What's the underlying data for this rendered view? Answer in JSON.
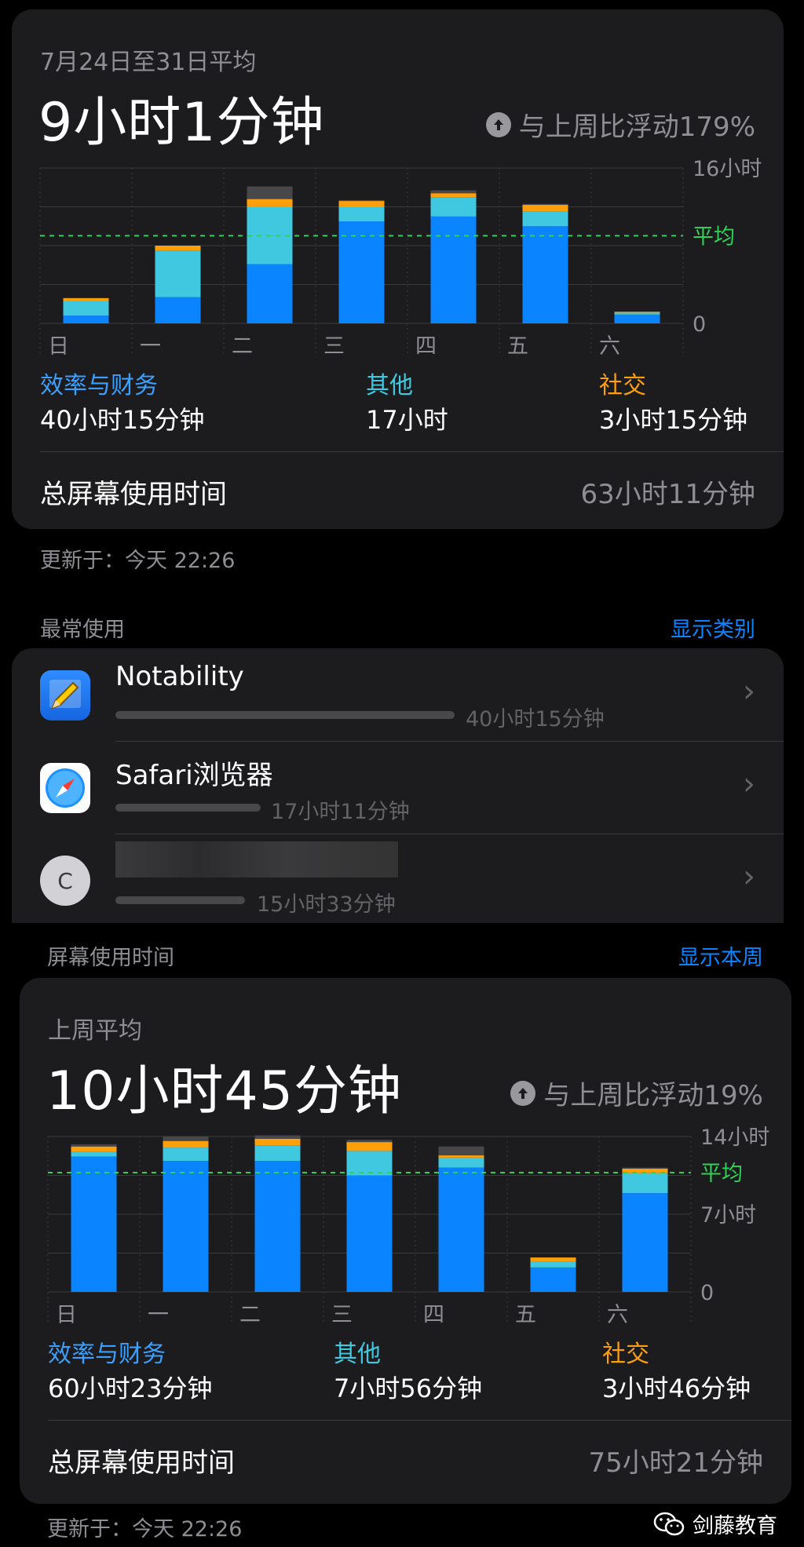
{
  "colors": {
    "productivity": "#0a84ff",
    "other": "#40c8e0",
    "social": "#ff9f0a",
    "misc": "#48484a",
    "average": "#30d158",
    "grid": "#3a3a3c",
    "link": "#0a84ff"
  },
  "summary1": {
    "range_label": "7月24日至31日平均",
    "avg": "9小时1分钟",
    "compare": "与上周比浮动179%",
    "legend": [
      {
        "name": "效率与财务",
        "value": "40小时15分钟",
        "color": "#3aa0ff"
      },
      {
        "name": "其他",
        "value": "17小时",
        "color": "#40c8e0"
      },
      {
        "name": "社交",
        "value": "3小时15分钟",
        "color": "#ff9f0a"
      }
    ],
    "total_label": "总屏幕使用时间",
    "total_value": "63小时11分钟"
  },
  "updated1": "更新于：今天 22:26",
  "most_used": {
    "title": "最常使用",
    "link": "显示类别",
    "apps": [
      {
        "name": "Notability",
        "time": "40小时15分钟",
        "usage": 40.25,
        "icon": "notability-icon"
      },
      {
        "name": "Safari浏览器",
        "time": "17小时11分钟",
        "usage": 17.18,
        "icon": "safari-icon"
      },
      {
        "name": "",
        "time": "15小时33分钟",
        "usage": 15.55,
        "icon": "c-avatar-icon",
        "letter": "C"
      }
    ]
  },
  "screen_time": {
    "title": "屏幕使用时间",
    "link": "显示本周"
  },
  "summary2": {
    "range_label": "上周平均",
    "avg": "10小时45分钟",
    "compare": "与上周比浮动19%",
    "legend": [
      {
        "name": "效率与财务",
        "value": "60小时23分钟",
        "color": "#3aa0ff"
      },
      {
        "name": "其他",
        "value": "7小时56分钟",
        "color": "#40c8e0"
      },
      {
        "name": "社交",
        "value": "3小时46分钟",
        "color": "#ff9f0a"
      }
    ],
    "total_label": "总屏幕使用时间",
    "total_value": "75小时21分钟"
  },
  "updated2": "更新于：今天 22:26",
  "watermark": "剑藤教育",
  "chart_data": [
    {
      "type": "bar",
      "stacked": true,
      "categories": [
        "日",
        "一",
        "二",
        "三",
        "四",
        "五",
        "六"
      ],
      "series": [
        {
          "name": "效率与财务",
          "values": [
            0.8,
            2.7,
            6.1,
            10.5,
            11.0,
            10.0,
            0.9
          ]
        },
        {
          "name": "其他",
          "values": [
            1.5,
            4.8,
            5.9,
            1.5,
            2.0,
            1.5,
            0.2
          ]
        },
        {
          "name": "社交",
          "values": [
            0.3,
            0.5,
            0.8,
            0.6,
            0.4,
            0.7,
            0.1
          ]
        },
        {
          "values": [
            0.0,
            0.0,
            1.3,
            0.1,
            0.3,
            0.1,
            0.0
          ]
        }
      ],
      "ylim": [
        0,
        16
      ],
      "ytick_labels": [
        {
          "value": 16,
          "label": "16小时"
        },
        {
          "value": 0,
          "label": "0"
        }
      ],
      "average": 9.02,
      "average_label": "平均",
      "grid": true
    },
    {
      "type": "bar",
      "stacked": true,
      "categories": [
        "日",
        "一",
        "二",
        "三",
        "四",
        "五",
        "六"
      ],
      "series": [
        {
          "name": "效率与财务",
          "values": [
            12.2,
            11.8,
            11.8,
            10.5,
            11.2,
            2.2,
            8.9
          ]
        },
        {
          "name": "其他",
          "values": [
            0.4,
            1.2,
            1.4,
            2.2,
            0.9,
            0.5,
            1.8
          ]
        },
        {
          "name": "社交",
          "values": [
            0.5,
            0.6,
            0.6,
            0.8,
            0.2,
            0.4,
            0.4
          ]
        },
        {
          "values": [
            0.2,
            0.4,
            0.3,
            0.2,
            0.8,
            0.0,
            0.1
          ]
        }
      ],
      "ylim": [
        0,
        14
      ],
      "ytick_labels": [
        {
          "value": 14,
          "label": "14小时"
        },
        {
          "value": 7,
          "label": "7小时"
        },
        {
          "value": 0,
          "label": "0"
        }
      ],
      "average": 10.75,
      "average_label": "平均",
      "grid": true
    }
  ]
}
